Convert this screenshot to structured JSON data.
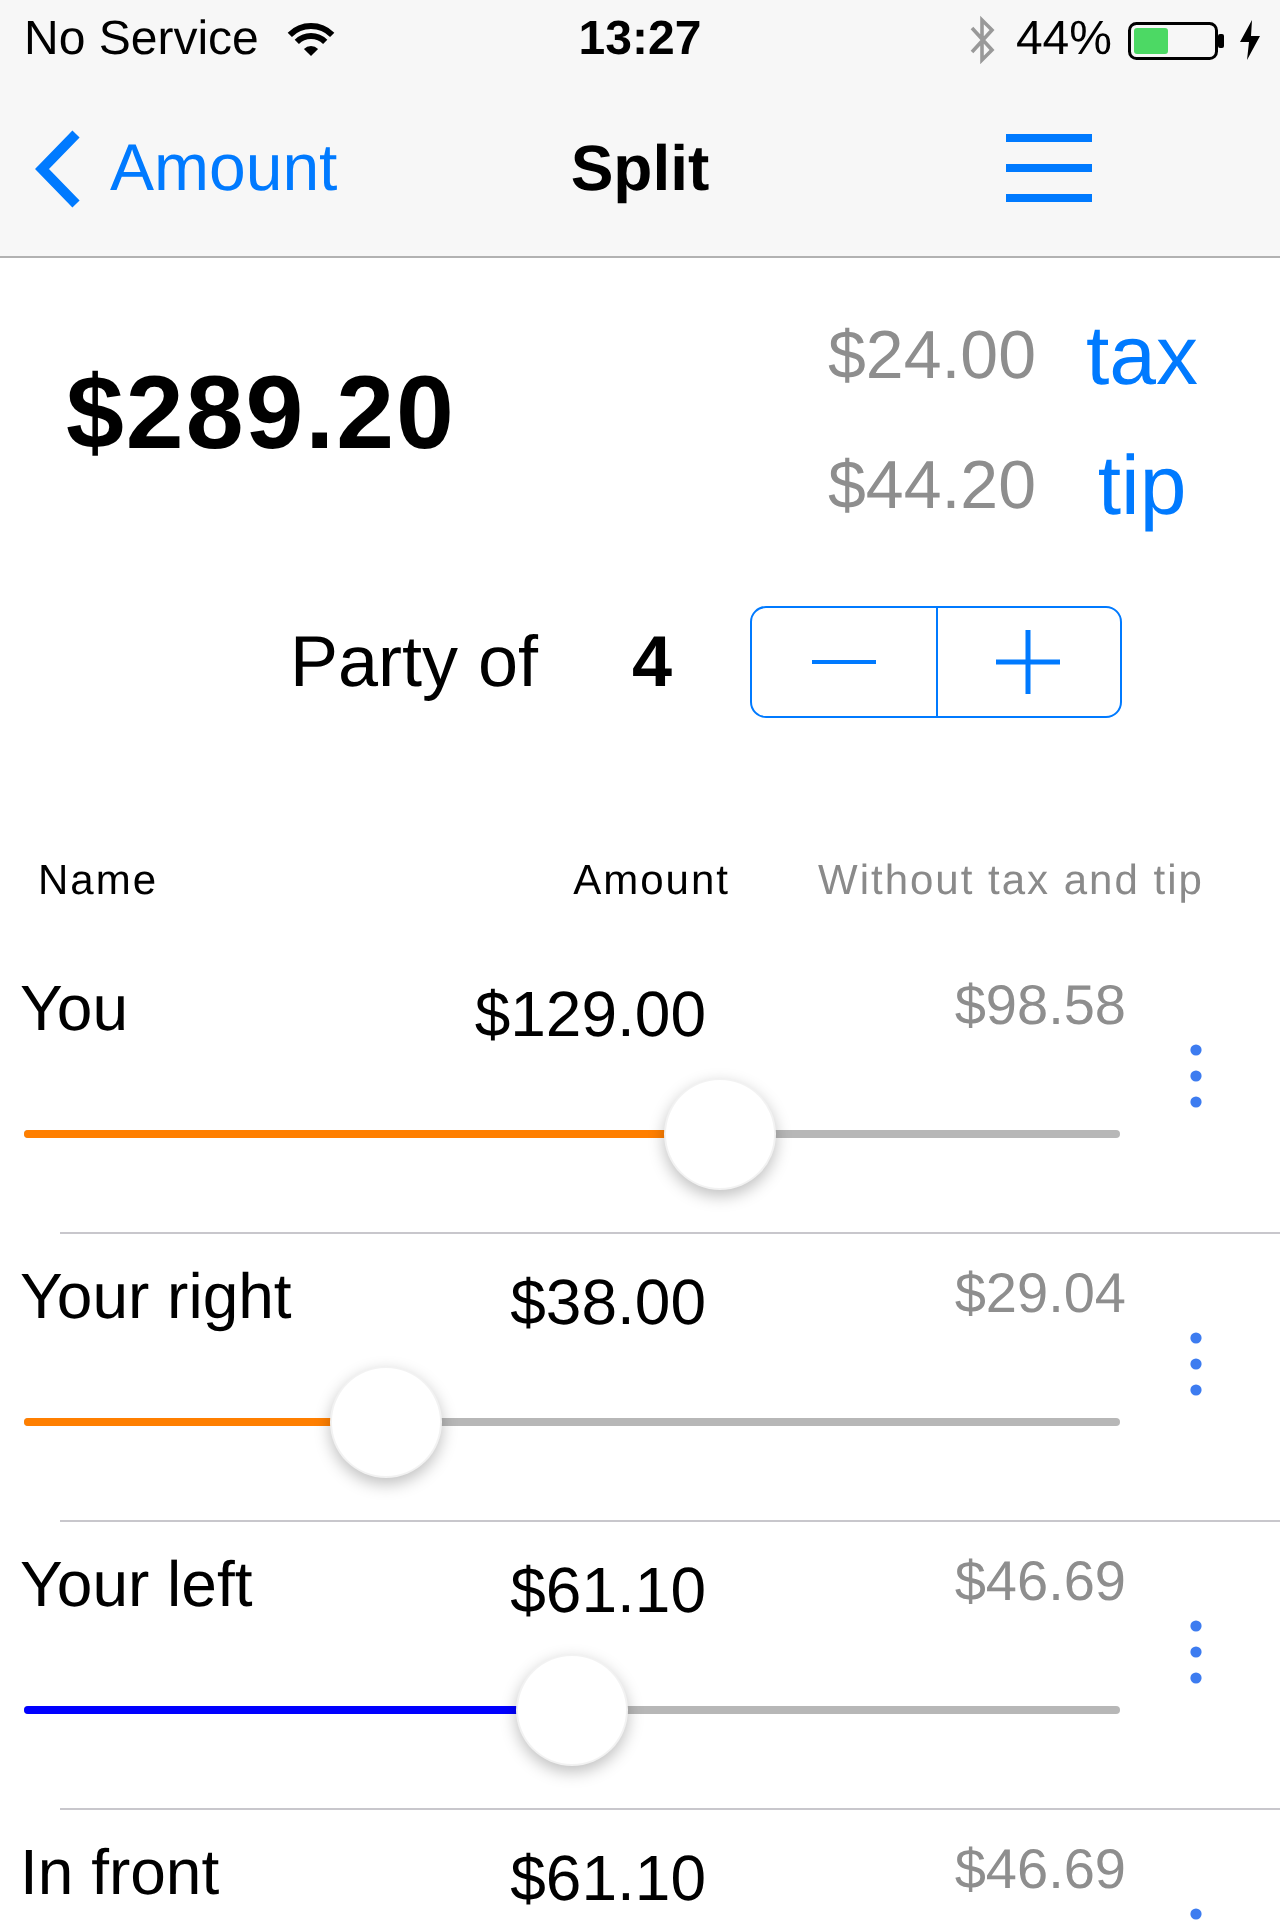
{
  "status_bar": {
    "carrier": "No Service",
    "time": "13:27",
    "battery": "44%"
  },
  "nav_bar": {
    "back": "Amount",
    "title": "Split"
  },
  "total": "$289.20",
  "charges": [
    {
      "amount": "$24.00",
      "label": "tax"
    },
    {
      "amount": "$44.20",
      "label": "tip"
    }
  ],
  "party": {
    "label": "Party of",
    "count": "4"
  },
  "table": {
    "columns": [
      "Name",
      "Amount",
      "Without tax and tip"
    ],
    "rows": [
      {
        "name": "You",
        "amount": "$129.00",
        "without_tax_and_tip": "$98.58",
        "level": 0.65,
        "color": "#ff7f00"
      },
      {
        "name": "Your right",
        "amount": "$38.00",
        "without_tax_and_tip": "$29.04",
        "level": 0.31,
        "color": "#ff7f00"
      },
      {
        "name": "Your left",
        "amount": "$61.10",
        "without_tax_and_tip": "$46.69",
        "level": 0.5,
        "color": "#0000ff"
      },
      {
        "name": "In front",
        "amount": "$61.10",
        "without_tax_and_tip": "$46.69"
      }
    ]
  }
}
